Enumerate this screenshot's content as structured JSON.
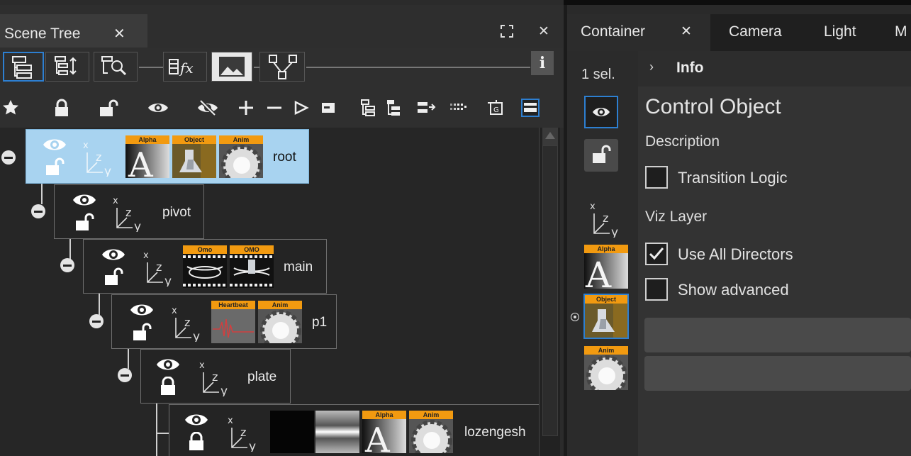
{
  "left_panel": {
    "tab": {
      "title": "Scene Tree",
      "close": "✕"
    },
    "window_controls": {
      "maximize": "⛶",
      "close": "✕"
    },
    "info_button": "i"
  },
  "tree": {
    "nodes": [
      {
        "label": "root",
        "selected": true,
        "thumbs": [
          "Alpha",
          "Object",
          "Anim"
        ]
      },
      {
        "label": "pivot",
        "selected": false,
        "thumbs": []
      },
      {
        "label": "main",
        "selected": false,
        "thumbs": [
          "Omo",
          "OMO"
        ]
      },
      {
        "label": "p1",
        "selected": false,
        "thumbs": [
          "Heartbeat",
          "Anim"
        ]
      },
      {
        "label": "plate",
        "selected": false,
        "thumbs": []
      },
      {
        "label": "lozengesh",
        "selected": false,
        "thumbs": [
          "",
          "",
          "Alpha",
          "Anim"
        ]
      }
    ],
    "axis_labels": {
      "x": "x",
      "z": "z",
      "y": "y"
    }
  },
  "right_panel": {
    "tabs": [
      {
        "label": "Container",
        "active": true,
        "close": "✕"
      },
      {
        "label": "Camera",
        "active": false
      },
      {
        "label": "Light",
        "active": false
      },
      {
        "label": "M",
        "active": false
      }
    ],
    "selection_count": "1 sel.",
    "sidebar_thumbs": [
      "Alpha",
      "Object",
      "Anim"
    ],
    "info_header": "Info",
    "object_title": "Control Object",
    "description_label": "Description",
    "transition_logic": {
      "label": "Transition Logic",
      "checked": false
    },
    "viz_layer_label": "Viz Layer",
    "use_all_directors": {
      "label": "Use All Directors",
      "checked": true
    },
    "show_advanced": {
      "label": "Show advanced",
      "checked": false
    }
  },
  "colors": {
    "selection": "#a8d3f0",
    "accent_blue": "#2d7fd1",
    "thumb_header": "#f29a10"
  }
}
